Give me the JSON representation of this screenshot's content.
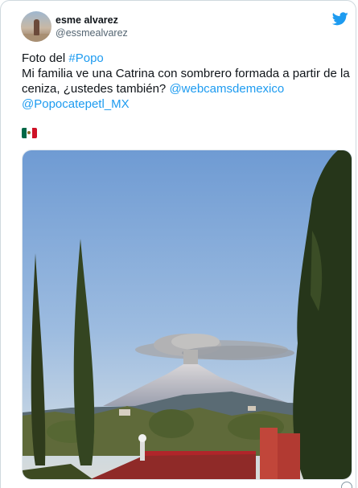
{
  "user": {
    "display_name": "esme alvarez",
    "handle": "@essmealvarez"
  },
  "tweet": {
    "line1_prefix": "Foto del ",
    "hashtag_popo": "#Popo",
    "line2": "Mi familia ve una Catrina con sombrero formada a partir de la ceniza, ¿ustedes también? ",
    "mention_webcams": "@webcamsdemexico",
    "mention_popocatepetl": "@Popocatepetl_MX",
    "flag_emoji": "mexico-flag-emoji"
  },
  "icons": {
    "brand": "twitter-bird-icon",
    "avatar": "user-avatar"
  },
  "colors": {
    "link": "#1d9bf0",
    "text": "#0f1419",
    "secondary": "#536471",
    "border": "#cfd9de",
    "brand": "#1d9bf0"
  }
}
